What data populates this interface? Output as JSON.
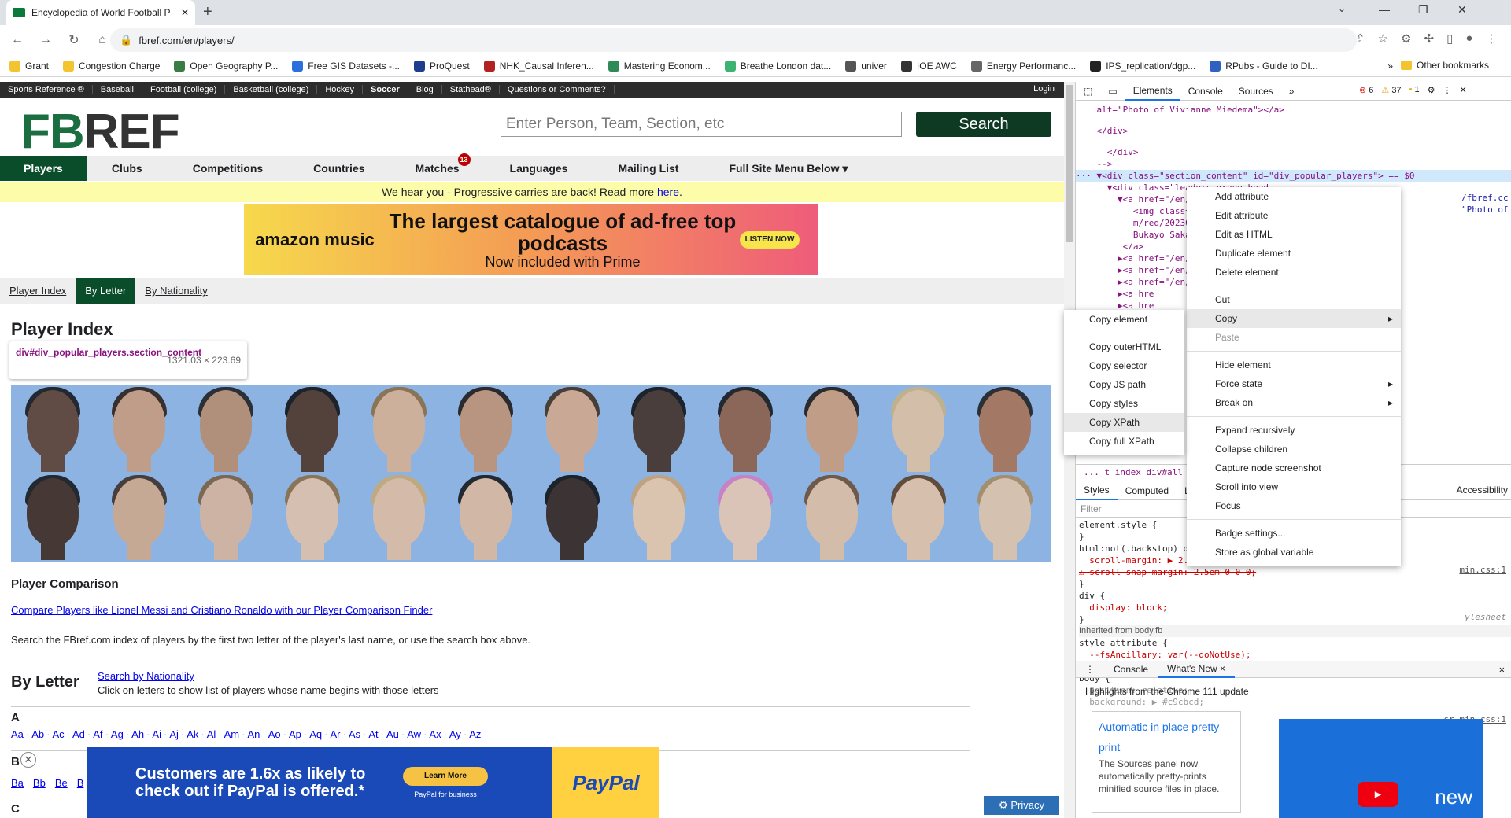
{
  "browser": {
    "tab_title": "Encyclopedia of World Football P",
    "new_tab": "+",
    "url": "fbref.com/en/players/",
    "bookmarks": [
      {
        "label": "Grant",
        "color": "#f4c430"
      },
      {
        "label": "Congestion Charge",
        "color": "#f4c430"
      },
      {
        "label": "Open Geography P...",
        "color": "#3a7d44"
      },
      {
        "label": "Free GIS Datasets -...",
        "color": "#2a6fdb"
      },
      {
        "label": "ProQuest",
        "color": "#1e3d8f"
      },
      {
        "label": "NHK_Causal Inferen...",
        "color": "#b22222"
      },
      {
        "label": "Mastering Econom...",
        "color": "#2e8b57"
      },
      {
        "label": "Breathe London dat...",
        "color": "#3cb371"
      },
      {
        "label": "univer",
        "color": "#555555"
      },
      {
        "label": "IOE AWC",
        "color": "#333333"
      },
      {
        "label": "Energy Performanc...",
        "color": "#666666"
      },
      {
        "label": "IPS_replication/dgp...",
        "color": "#222222"
      },
      {
        "label": "RPubs - Guide to DI...",
        "color": "#3060c0"
      }
    ],
    "other_bookmarks": "Other bookmarks"
  },
  "site": {
    "topbar": [
      "Sports Reference ®",
      "Baseball",
      "Football (college)",
      "Basketball (college)",
      "Hockey",
      "Soccer",
      "Blog",
      "Stathead®",
      "Questions or Comments?"
    ],
    "login": "Login",
    "logo_a": "FB",
    "logo_b": "REF",
    "search_placeholder": "Enter Person, Team, Section, etc",
    "search_button": "Search",
    "nav": [
      "Players",
      "Clubs",
      "Competitions",
      "Countries",
      "Matches",
      "Languages",
      "Mailing List",
      "Full Site Menu Below ▾"
    ],
    "matches_badge": "13",
    "notice_text": "We hear you - Progressive carries are back! Read more ",
    "notice_link": "here",
    "ad1": {
      "brand": "amazon music",
      "headline": "The largest catalogue of ad-free top podcasts",
      "sub": "Now included with Prime",
      "cta": "LISTEN NOW"
    },
    "subnav": [
      "Player Index",
      "By Letter",
      "By Nationality"
    ],
    "page_title": "Player Index",
    "tooltip_selector": "div#div_popular_players.section_content",
    "tooltip_size": "1321.03 × 223.69",
    "comparison_title": "Player Comparison",
    "comparison_link": "Compare Players like Lionel Messi and Cristiano Ronaldo with our Player Comparison Finder",
    "search_text": "Search the FBref.com index of players by the first two letter of the player's last name, or use the search box above.",
    "by_letter_title": "By Letter",
    "by_nationality_link": "Search by Nationality",
    "by_letter_desc": "Click on letters to show list of players whose name begins with those letters",
    "letter_a": "A",
    "a_links": [
      "Aa",
      "Ab",
      "Ac",
      "Ad",
      "Af",
      "Ag",
      "Ah",
      "Ai",
      "Aj",
      "Ak",
      "Al",
      "Am",
      "An",
      "Ao",
      "Ap",
      "Aq",
      "Ar",
      "As",
      "At",
      "Au",
      "Aw",
      "Ax",
      "Ay",
      "Az"
    ],
    "letter_b": "B",
    "b_links": [
      "Ba",
      "Bb",
      "Be",
      "B"
    ],
    "letter_c": "C",
    "ad2": {
      "headline": "Customers are 1.6x as likely to check out if PayPal is offered.*",
      "cta": "Learn More",
      "sub": "PayPal for business",
      "brand": "PayPal"
    },
    "privacy": "Privacy",
    "skin_tones": [
      "#5a3a2a",
      "#c99a7a",
      "#b88a6a",
      "#4a2e20",
      "#d8b090",
      "#c09070",
      "#d4a888",
      "#3e2a20",
      "#8a5a40",
      "#c89a78",
      "#e0c0a0",
      "#a87050",
      "#3a2418",
      "#d0a888",
      "#d8b49a",
      "#e2c2a8",
      "#e0bca0",
      "#dcb89c",
      "#2e1e16",
      "#e8c8a8",
      "#e8c8b0",
      "#e0bea0",
      "#e4c2a4",
      "#e2c4a8"
    ],
    "hair_colors": [
      "#111",
      "#2a1a10",
      "#1a1a1a",
      "#0a0a0a",
      "#8a6a40",
      "#1a1410",
      "#3a2a1a",
      "#0a0a0a",
      "#111",
      "#1a1410",
      "#c8b080",
      "#1a1a1a",
      "#111",
      "#3a2a20",
      "#7a5a3a",
      "#8a6a40",
      "#c8a870",
      "#111",
      "#0a0a0a",
      "#c8a070",
      "#d07ac0",
      "#6a4a30",
      "#5a3a20",
      "#a8885a"
    ]
  },
  "devtools": {
    "tabs": [
      "Elements",
      "Console",
      "Sources",
      "»"
    ],
    "errors": "6",
    "warnings": "37",
    "issues": "1",
    "code_lines": [
      "    alt=\"Photo of Vivianne Miedema\"></a>",
      "",
      "    </div>",
      "",
      "      </div>",
      "    -->",
      "··· ▼<div class=\"section_content\" id=\"div_popular_players\"> == $0",
      "      ▼<div class=\"leaders_group_head",
      "        ▼<a href=\"/en/players/bc7dc64d",
      "           <img class=\"poptip\" data-ti",
      "           m/req/202302030/images/head",
      "           Bukayo Saka\">",
      "         </a>",
      "        ▶<a href=\"/en/players/dea698d9",
      "        ▶<a href=\"/en/players/4d224fe8",
      "        ▶<a href=\"/en/players/1f264a87",
      "        ▶<a hre",
      "        ▶<a hre",
      "        ▶<a hre",
      "        ▶<a hre"
    ],
    "code_right": [
      "/fbref.cc",
      "\"Photo of"
    ],
    "breadcrumb": "...  t_index   div#all_pop                                               content",
    "style_tabs": [
      "Styles",
      "Computed",
      "L"
    ],
    "accessibility": "Accessibility",
    "filter": "Filter",
    "styles_lines": [
      "element.style {",
      "}",
      "html:not(.backstop) div, html:not(.backstop",
      "  scroll-margin: ▶ 2.5em 0 0 0;",
      "⚠ scroll-snap-margin: 2.5em 0 0 0;",
      "}",
      "div {",
      "  display: block;",
      "}",
      "Inherited from body.fb",
      "style attribute {",
      "  --fsAncillary: var(--doNotUse);",
      "}",
      "body {",
      "  position: relative;",
      "  background: ▶ #c9cbcd;"
    ],
    "styles_right": [
      "min.css:1",
      "ylesheet",
      "sr-min.css:1"
    ],
    "drawer_tabs": [
      "Console",
      "What's New ×"
    ],
    "highlights": "Highlights from the Chrome 111 update",
    "card_title": "Automatic in place pretty print",
    "card_desc": "The Sources panel now automatically pretty-prints minified source files in place.",
    "video_text": "new",
    "context_menu": [
      "Add attribute",
      "Edit attribute",
      "Edit as HTML",
      "Duplicate element",
      "Delete element",
      "Cut",
      "Copy",
      "Paste",
      "Hide element",
      "Force state",
      "Break on",
      "Expand recursively",
      "Collapse children",
      "Capture node screenshot",
      "Scroll into view",
      "Focus",
      "Badge settings...",
      "Store as global variable"
    ],
    "copy_submenu": [
      "Copy element",
      "Copy outerHTML",
      "Copy selector",
      "Copy JS path",
      "Copy styles",
      "Copy XPath",
      "Copy full XPath"
    ]
  }
}
